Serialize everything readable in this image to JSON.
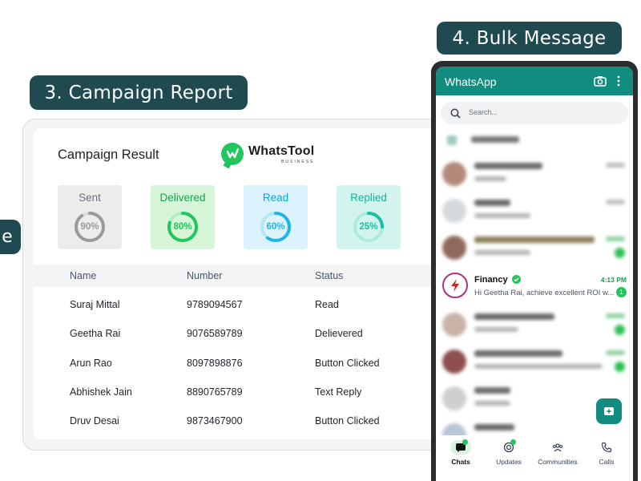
{
  "labels": {
    "partial_left": "e",
    "campaign_report": "3. Campaign Report",
    "bulk_message": "4. Bulk Message"
  },
  "report": {
    "title": "Campaign Result",
    "logo": {
      "name": "WhatsTool",
      "sub": "BUSINESS"
    },
    "stats": [
      {
        "label": "Sent",
        "value": "90%",
        "percent": 90,
        "color": "#9a9a9a",
        "label_color": "#6b7280"
      },
      {
        "label": "Delivered",
        "value": "80%",
        "percent": 80,
        "color": "#22c55e",
        "label_color": "#16a34a"
      },
      {
        "label": "Read",
        "value": "60%",
        "percent": 60,
        "color": "#1eb6e8",
        "label_color": "#0ea5e9"
      },
      {
        "label": "Replied",
        "value": "25%",
        "percent": 25,
        "color": "#16c2a3",
        "label_color": "#0fb89a"
      }
    ],
    "columns": [
      "Name",
      "Number",
      "Status"
    ],
    "rows": [
      {
        "name": "Suraj Mittal",
        "number": "9789094567",
        "status": "Read"
      },
      {
        "name": "Geetha Rai",
        "number": "9076589789",
        "status": "Delievered"
      },
      {
        "name": "Arun Rao",
        "number": "8097898876",
        "status": "Button Clicked"
      },
      {
        "name": "Abhishek Jain",
        "number": "8890765789",
        "status": "Text Reply"
      },
      {
        "name": "Druv Desai",
        "number": "9873467900",
        "status": "Button Clicked"
      }
    ]
  },
  "whatsapp": {
    "title": "WhatsApp",
    "search_placeholder": "Search...",
    "featured_chat": {
      "name": "Financy",
      "time": "4:13 PM",
      "message": "Hi Geetha Rai, achieve excellent ROI  w...",
      "unread": "1"
    },
    "nav": [
      "Chats",
      "Updates",
      "Communities",
      "Calls"
    ],
    "accent_color": "#128c7e"
  }
}
